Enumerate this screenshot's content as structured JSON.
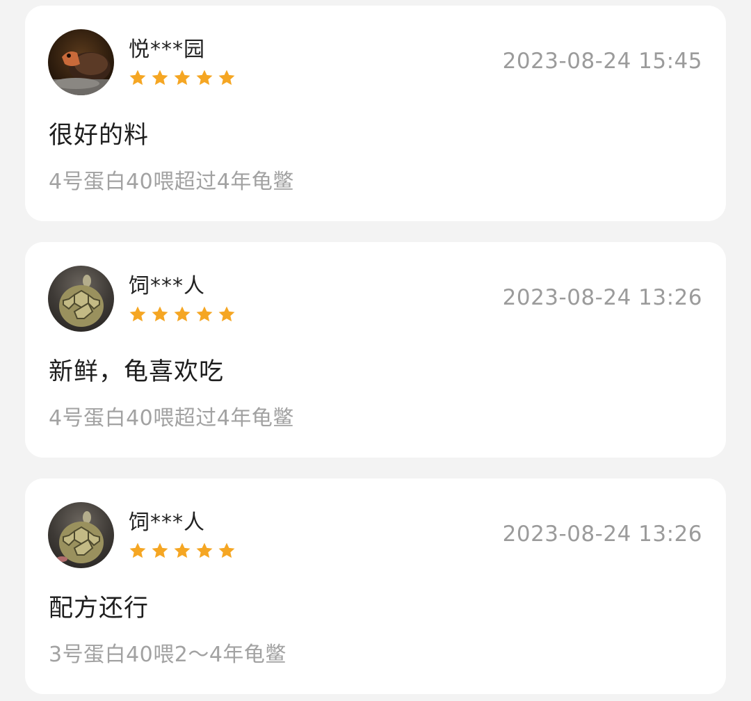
{
  "reviews": [
    {
      "username": "悦***园",
      "rating": 5,
      "timestamp": "2023-08-24 15:45",
      "text": "很好的料",
      "spec": "4号蛋白40喂超过4年龟鳖",
      "avatar": "turtle-red-avatar"
    },
    {
      "username": "饲***人",
      "rating": 5,
      "timestamp": "2023-08-24 13:26",
      "text": "新鲜，龟喜欢吃",
      "spec": "4号蛋白40喂超过4年龟鳖",
      "avatar": "turtle-shell-avatar"
    },
    {
      "username": "饲***人",
      "rating": 5,
      "timestamp": "2023-08-24 13:26",
      "text": "配方还行",
      "spec": "3号蛋白40喂2～4年龟鳖",
      "avatar": "turtle-shell-avatar"
    }
  ],
  "colors": {
    "star": "#f5a623",
    "timestamp": "#9b9b9b",
    "spec": "#a2a2a2",
    "card_bg": "#ffffff",
    "page_bg": "#f3f3f3"
  }
}
